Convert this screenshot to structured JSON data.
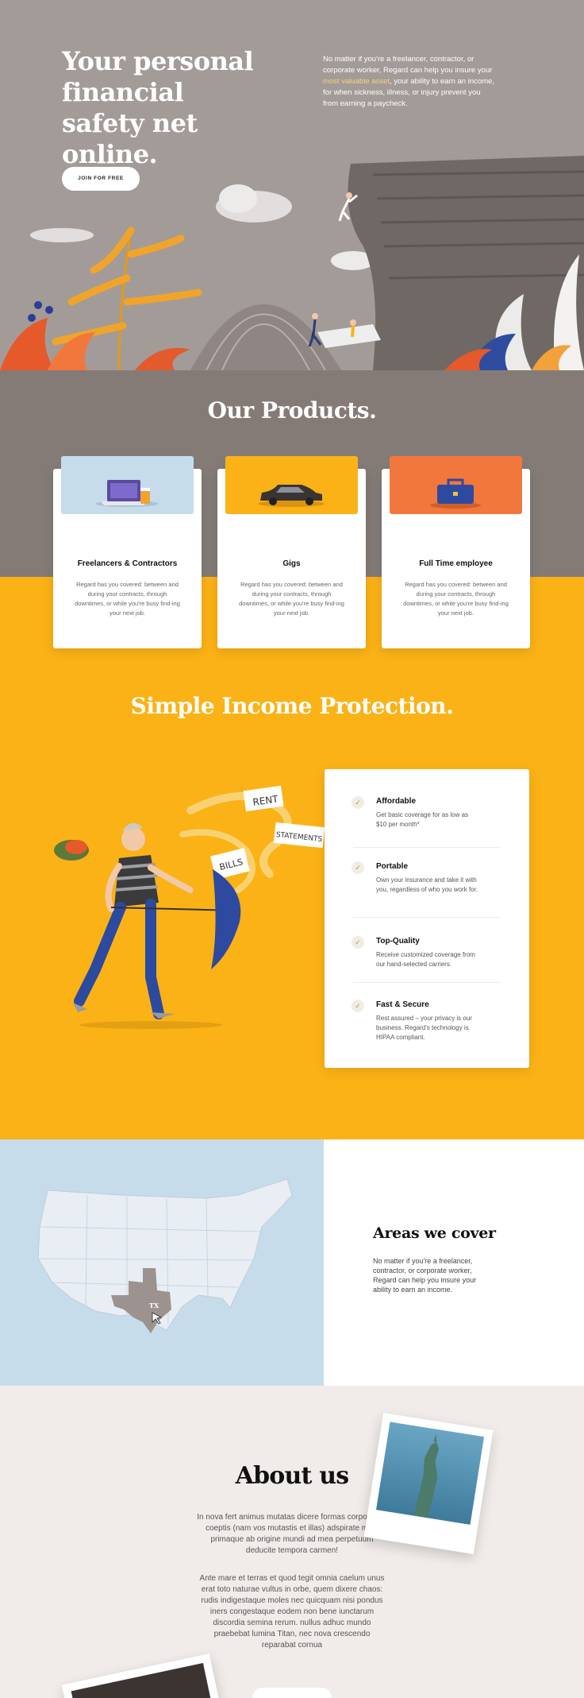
{
  "hero": {
    "headline": "Your personal financial safety net online.",
    "description_before": "No matter if you're a freelancer, contractor, or corporate worker, Regard can help you insure your ",
    "description_highlight": "most valuable asset",
    "description_after": ", your ability to earn an income, for when sickness, illness, or injury prevent you from earning a paycheck.",
    "cta_label": "JOIN FOR FREE"
  },
  "products": {
    "title": "Our Products.",
    "items": [
      {
        "title": "Freelancers & Contractors",
        "description": "Regard has you covered: between and during your contracts, through downtimes, or while you're busy find-ing your next job.",
        "color": "#c7dceb",
        "icon": "laptop-coffee-icon"
      },
      {
        "title": "Gigs",
        "description": "Regard has you covered: between and during your contracts, through downtimes, or while you're busy find-ing your next job.",
        "color": "#fbb216",
        "icon": "car-icon"
      },
      {
        "title": "Full Time employee",
        "description": "Regard has you covered: between and during your contracts, through downtimes, or while you're busy find-ing your next job.",
        "color": "#f2773d",
        "icon": "briefcase-icon"
      }
    ]
  },
  "protection": {
    "title": "Simple Income Protection.",
    "illustration_notes": [
      "RENT",
      "STATEMENTS",
      "BILLS"
    ],
    "features": [
      {
        "title": "Affordable",
        "description": "Get basic coverage for as low as $10 per month*"
      },
      {
        "title": "Portable",
        "description": "Own your insurance and take it with you, regardless of who you work for."
      },
      {
        "title": "Top-Quality",
        "description": "Receive customized coverage from our hand-selected carriers."
      },
      {
        "title": "Fast & Secure",
        "description": "Rest assured – your privacy is our business. Regard's technology is HIPAA compliant."
      }
    ]
  },
  "areas": {
    "title": "Areas we cover",
    "description": "No matter if you're a freelancer, contractor, or corporate worker, Regard can help you insure your ability to earn an income.",
    "state_label": "TX"
  },
  "about": {
    "title": "About us",
    "paragraph1": "In nova fert animus mutatas dicere formas corpora; di, coeptis (nam vos mutastis et illas) adspirate meis primaque ab origine mundi ad mea perpetuum deducite tempora carmen!",
    "paragraph2": "Ante mare et terras et quod tegit omnia caelum unus erat toto naturae vultus in orbe, quem dixere chaos: rudis indigestaque moles nec quicquam nisi pondus iners congestaque eodem non bene iunctarum discordia semina rerum. nullus adhuc mundo praebebat lumina Titan, nec nova crescendo reparabat cornua"
  },
  "colors": {
    "hero_bg": "#a39b98",
    "products_bg": "#847b77",
    "accent_yellow": "#fbb216",
    "map_bg": "#c7dceb",
    "orange": "#f2773d"
  }
}
